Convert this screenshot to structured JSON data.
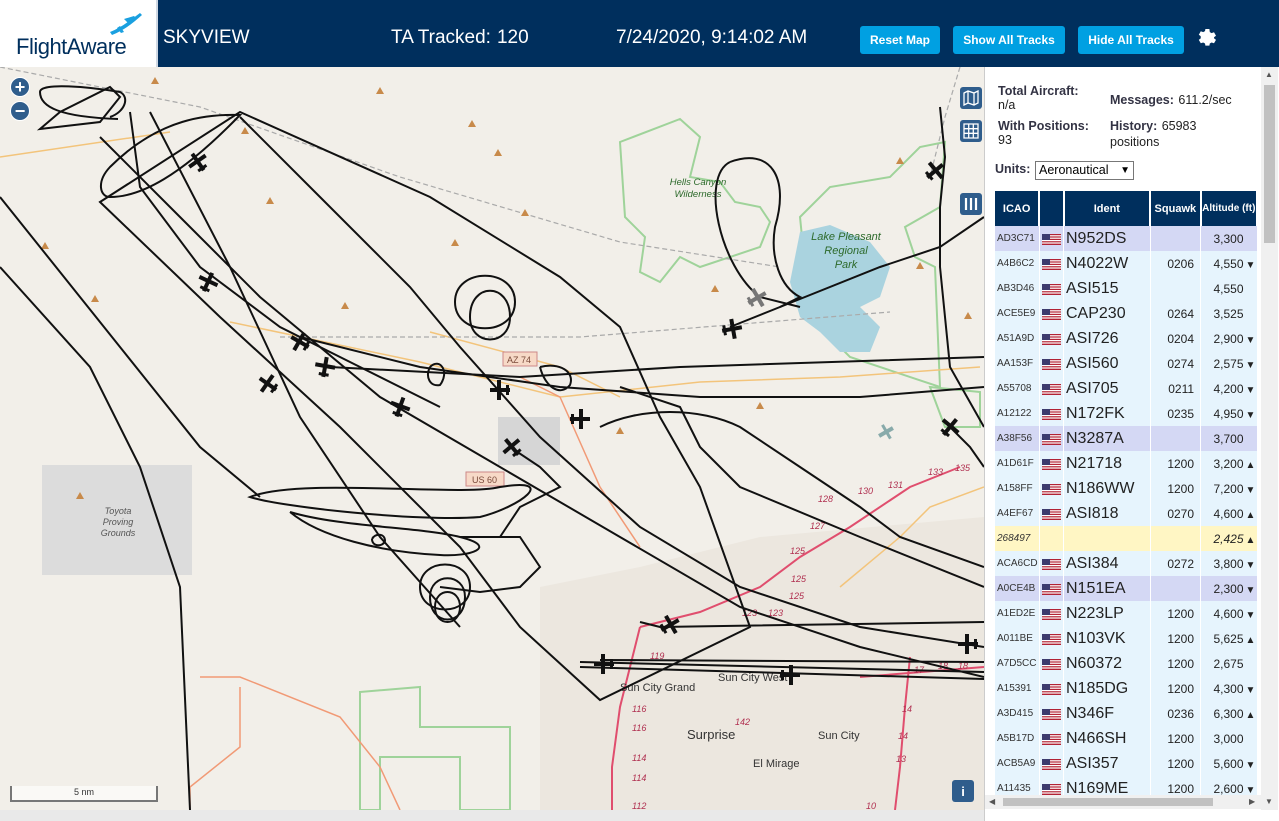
{
  "header": {
    "logo_text": "FlightAware",
    "app_name": "SKYVIEW",
    "tracked_label": "TA Tracked:",
    "tracked_count": "120",
    "datetime": "7/24/2020, 9:14:02 AM",
    "buttons": {
      "reset": "Reset Map",
      "show_all": "Show All Tracks",
      "hide_all": "Hide All Tracks"
    },
    "settings_icon": "gear-icon",
    "colors": {
      "bar": "#002f5d",
      "button": "#00a0e2"
    }
  },
  "map": {
    "zoom_in": "+",
    "zoom_out": "−",
    "scale_label": "5 nm",
    "info_label": "i",
    "place_labels": {
      "hells_canyon": [
        "Hells Canyon",
        "Wilderness"
      ],
      "lake_pleasant": [
        "Lake Pleasant",
        "Regional",
        "Park"
      ],
      "toyota": [
        "Toyota",
        "Proving",
        "Grounds"
      ],
      "sun_city_grand": "Sun City Grand",
      "sun_city_west": "Sun City West",
      "sun_city": "Sun City",
      "surprise": "Surprise",
      "el_mirage": "El Mirage",
      "az74": "AZ 74",
      "us60": "US 60"
    },
    "road_numbers": [
      "119",
      "116",
      "116",
      "114",
      "114",
      "112",
      "142",
      "123",
      "123",
      "125",
      "125",
      "125",
      "127",
      "128",
      "130",
      "131",
      "133",
      "135",
      "17",
      "18",
      "18",
      "14",
      "14",
      "13",
      "10"
    ]
  },
  "stats": {
    "total_label": "Total Aircraft:",
    "total_value": "n/a",
    "positions_label": "With Positions:",
    "positions_value": "93",
    "messages_label": "Messages:",
    "messages_value": "611.2/sec",
    "history_label": "History:",
    "history_value": "65983",
    "history_unit": "positions",
    "units_label": "Units:",
    "units_value": "Aeronautical"
  },
  "table": {
    "headers": [
      "ICAO",
      "",
      "Ident",
      "Squawk",
      "Altitude (ft)"
    ],
    "rows": [
      {
        "icao": "AD3C71",
        "ident": "N952DS",
        "squawk": "",
        "alt": "3,300",
        "trend": "",
        "style": "sel"
      },
      {
        "icao": "A4B6C2",
        "ident": "N4022W",
        "squawk": "0206",
        "alt": "4,550",
        "trend": "▼",
        "style": "norm"
      },
      {
        "icao": "AB3D46",
        "ident": "ASI515",
        "squawk": "",
        "alt": "4,550",
        "trend": "",
        "style": "norm"
      },
      {
        "icao": "ACE5E9",
        "ident": "CAP230",
        "squawk": "0264",
        "alt": "3,525",
        "trend": "",
        "style": "norm"
      },
      {
        "icao": "A51A9D",
        "ident": "ASI726",
        "squawk": "0204",
        "alt": "2,900",
        "trend": "▼",
        "style": "norm"
      },
      {
        "icao": "AA153F",
        "ident": "ASI560",
        "squawk": "0274",
        "alt": "2,575",
        "trend": "▼",
        "style": "norm"
      },
      {
        "icao": "A55708",
        "ident": "ASI705",
        "squawk": "0211",
        "alt": "4,200",
        "trend": "▼",
        "style": "norm"
      },
      {
        "icao": "A12122",
        "ident": "N172FK",
        "squawk": "0235",
        "alt": "4,950",
        "trend": "▼",
        "style": "norm"
      },
      {
        "icao": "A38F56",
        "ident": "N3287A",
        "squawk": "",
        "alt": "3,700",
        "trend": "",
        "style": "sel"
      },
      {
        "icao": "A1D61F",
        "ident": "N21718",
        "squawk": "1200",
        "alt": "3,200",
        "trend": "▲",
        "style": "norm"
      },
      {
        "icao": "A158FF",
        "ident": "N186WW",
        "squawk": "1200",
        "alt": "7,200",
        "trend": "▼",
        "style": "norm"
      },
      {
        "icao": "A4EF67",
        "ident": "ASI818",
        "squawk": "0270",
        "alt": "4,600",
        "trend": "▲",
        "style": "norm"
      },
      {
        "icao": "268497",
        "ident": "",
        "squawk": "",
        "alt": "2,425",
        "trend": "▲",
        "style": "yel"
      },
      {
        "icao": "ACA6CD",
        "ident": "ASI384",
        "squawk": "0272",
        "alt": "3,800",
        "trend": "▼",
        "style": "norm"
      },
      {
        "icao": "A0CE4B",
        "ident": "N151EA",
        "squawk": "",
        "alt": "2,300",
        "trend": "▼",
        "style": "sel"
      },
      {
        "icao": "A1ED2E",
        "ident": "N223LP",
        "squawk": "1200",
        "alt": "4,600",
        "trend": "▼",
        "style": "norm"
      },
      {
        "icao": "A011BE",
        "ident": "N103VK",
        "squawk": "1200",
        "alt": "5,625",
        "trend": "▲",
        "style": "norm"
      },
      {
        "icao": "A7D5CC",
        "ident": "N60372",
        "squawk": "1200",
        "alt": "2,675",
        "trend": "",
        "style": "norm"
      },
      {
        "icao": "A15391",
        "ident": "N185DG",
        "squawk": "1200",
        "alt": "4,300",
        "trend": "▼",
        "style": "norm"
      },
      {
        "icao": "A3D415",
        "ident": "N346F",
        "squawk": "0236",
        "alt": "6,300",
        "trend": "▲",
        "style": "norm"
      },
      {
        "icao": "A5B17D",
        "ident": "N466SH",
        "squawk": "1200",
        "alt": "3,000",
        "trend": "",
        "style": "norm"
      },
      {
        "icao": "ACB5A9",
        "ident": "ASI357",
        "squawk": "1200",
        "alt": "5,600",
        "trend": "▼",
        "style": "norm"
      },
      {
        "icao": "A11435",
        "ident": "N169ME",
        "squawk": "1200",
        "alt": "2,600",
        "trend": "▼",
        "style": "norm"
      }
    ]
  }
}
